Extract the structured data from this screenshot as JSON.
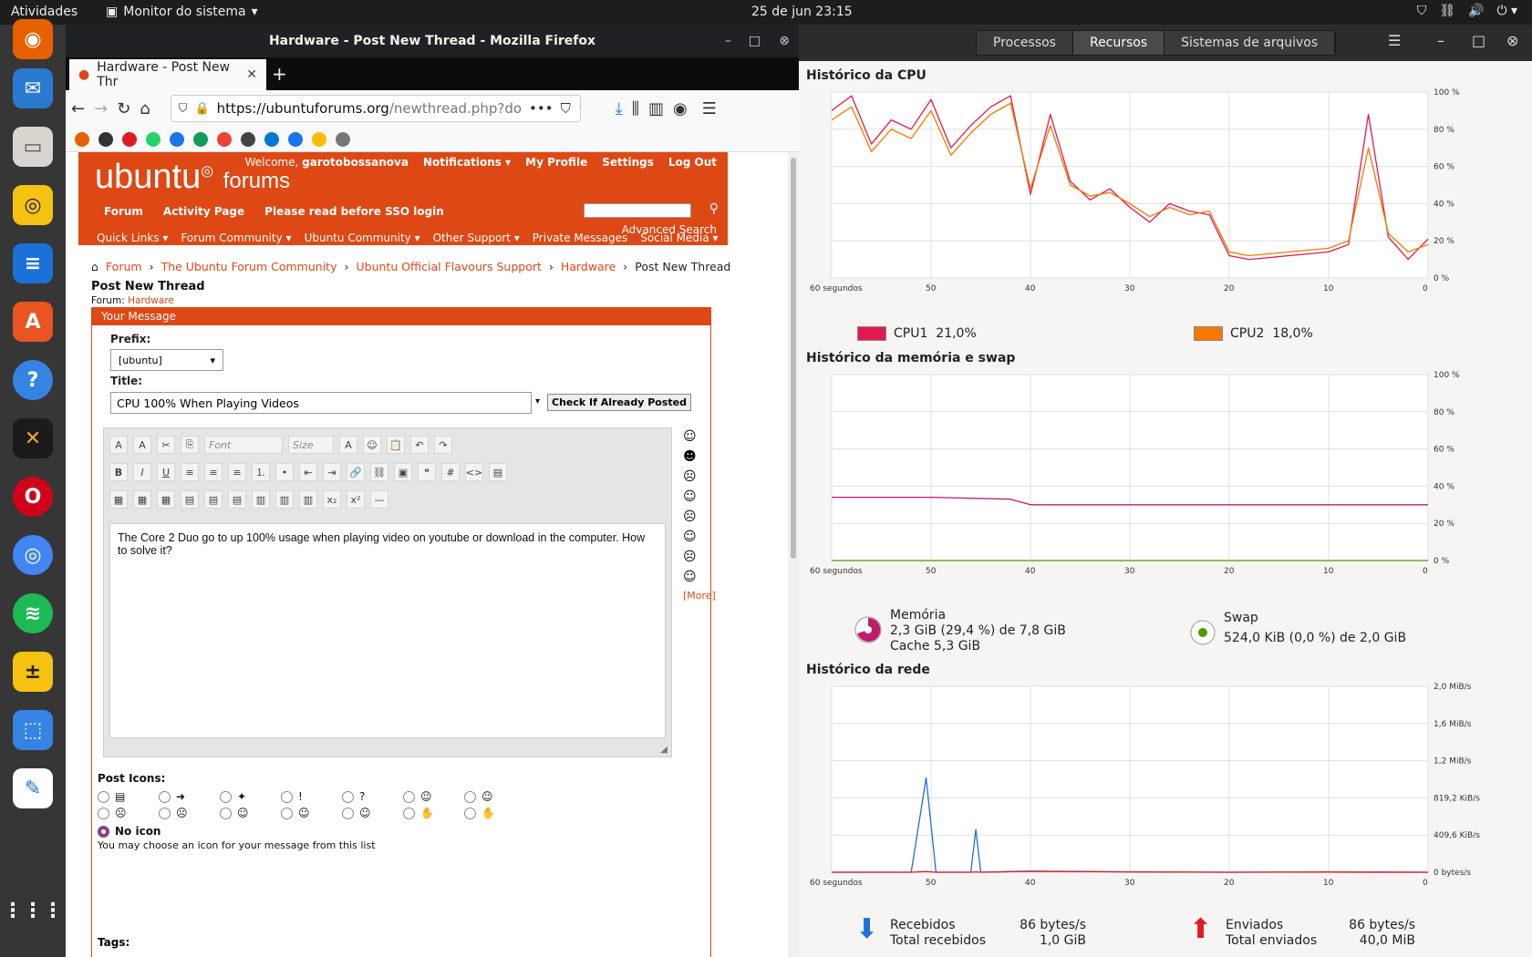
{
  "topbar": {
    "activities": "Atividades",
    "app": "Monitor do sistema",
    "datetime": "25 de jun  23:15"
  },
  "firefox": {
    "window_title": "Hardware - Post New Thread - Mozilla Firefox",
    "tab_title": "Hardware - Post New Thr",
    "url_host": "https://ubuntuforums.org",
    "url_path": "/newthread.php?do",
    "page": {
      "logo": "ubuntu",
      "logo_suffix": "forums",
      "welcome": "Welcome,",
      "username": "garotobossanova",
      "top_links": [
        "Notifications",
        "My Profile",
        "Settings",
        "Log Out"
      ],
      "nav1": [
        "Forum",
        "Activity Page",
        "Please read before SSO login"
      ],
      "nav2": [
        "Quick Links",
        "Forum Community",
        "Ubuntu Community",
        "Other Support",
        "Private Messages",
        "Social Media"
      ],
      "advanced_search": "Advanced Search",
      "breadcrumb": [
        "Forum",
        "The Ubuntu Forum Community",
        "Ubuntu Official Flavours Support",
        "Hardware"
      ],
      "breadcrumb_current": "Post New Thread",
      "heading": "Post New Thread",
      "forum_label": "Forum:",
      "forum_name": "Hardware",
      "panel_title": "Your Message",
      "prefix_label": "Prefix:",
      "prefix_value": "[ubuntu]",
      "title_label": "Title:",
      "title_value": "CPU 100% When Playing Videos",
      "check_button": "Check If Already Posted",
      "font_placeholder": "Font",
      "size_placeholder": "Size",
      "message": "The Core 2 Duo go to up 100% usage when playing video on youtube or download in the computer. How to solve it?",
      "more_smilies": "[More]",
      "post_icons_label": "Post Icons:",
      "no_icon": "No icon",
      "icon_hint": "You may choose an icon for your message from this list",
      "tags_label": "Tags:"
    }
  },
  "monitor": {
    "tabs": [
      "Processos",
      "Recursos",
      "Sistemas de arquivos"
    ],
    "cpu_title": "Histórico da CPU",
    "mem_title": "Histórico da memória e swap",
    "net_title": "Histórico da rede",
    "x_ticks": [
      "60 segundos",
      "50",
      "40",
      "30",
      "20",
      "10",
      "0"
    ],
    "pct_ticks": [
      "100 %",
      "80 %",
      "60 %",
      "40 %",
      "20 %",
      "0 %"
    ],
    "net_ticks": [
      "2,0 MiB/s",
      "1,6 MiB/s",
      "1,2 MiB/s",
      "819,2 KiB/s",
      "409,6 KiB/s",
      "0 bytes/s"
    ],
    "cpu1_label": "CPU1",
    "cpu1_value": "21,0%",
    "cpu2_label": "CPU2",
    "cpu2_value": "18,0%",
    "mem_label": "Memória",
    "mem_value": "2,3 GiB (29,4 %) de 7,8 GiB",
    "mem_cache": "Cache 5,3 GiB",
    "swap_label": "Swap",
    "swap_value": "524,0 KiB (0,0 %) de 2,0 GiB",
    "recv_label": "Recebidos",
    "recv_rate": "86 bytes/s",
    "recv_total_label": "Total recebidos",
    "recv_total": "1,0 GiB",
    "sent_label": "Enviados",
    "sent_rate": "86 bytes/s",
    "sent_total_label": "Total enviados",
    "sent_total": "40,0 MiB",
    "colors": {
      "cpu1": "#e01b4c",
      "cpu2": "#f57900",
      "mem": "#c01c6c",
      "swap": "#4e9a06",
      "recv": "#1c71d8",
      "sent": "#e01b24"
    }
  },
  "chart_data": [
    {
      "type": "line",
      "title": "Histórico da CPU",
      "x": [
        60,
        58,
        56,
        54,
        52,
        50,
        48,
        46,
        44,
        42,
        40,
        38,
        36,
        34,
        32,
        30,
        28,
        26,
        24,
        22,
        20,
        18,
        16,
        14,
        12,
        10,
        8,
        6,
        4,
        2,
        0
      ],
      "series": [
        {
          "name": "CPU1",
          "values": [
            90,
            98,
            72,
            85,
            80,
            96,
            70,
            82,
            92,
            98,
            45,
            88,
            52,
            42,
            48,
            38,
            30,
            40,
            36,
            34,
            12,
            10,
            11,
            12,
            13,
            14,
            18,
            88,
            22,
            10,
            21
          ]
        },
        {
          "name": "CPU2",
          "values": [
            85,
            92,
            68,
            80,
            75,
            90,
            66,
            78,
            88,
            94,
            48,
            82,
            50,
            44,
            46,
            40,
            33,
            38,
            34,
            36,
            14,
            12,
            13,
            14,
            15,
            16,
            20,
            70,
            24,
            14,
            18
          ]
        }
      ],
      "ylim": [
        0,
        100
      ]
    },
    {
      "type": "line",
      "title": "Histórico da memória e swap",
      "x": [
        60,
        50,
        42,
        40,
        30,
        20,
        10,
        0
      ],
      "series": [
        {
          "name": "Memória",
          "values": [
            34,
            34,
            33,
            30,
            30,
            30,
            30,
            30
          ]
        },
        {
          "name": "Swap",
          "values": [
            0,
            0,
            0,
            0,
            0,
            0,
            0,
            0
          ]
        }
      ],
      "ylim": [
        0,
        100
      ]
    },
    {
      "type": "line",
      "title": "Histórico da rede",
      "x": [
        60,
        52,
        50.5,
        49.5,
        48,
        46,
        45.5,
        45,
        40,
        30,
        20,
        10,
        0
      ],
      "series": [
        {
          "name": "Recebidos",
          "values": [
            0,
            0,
            1040,
            0,
            0,
            0,
            470,
            0,
            12,
            4,
            0,
            2,
            0
          ]
        },
        {
          "name": "Enviados",
          "values": [
            0,
            0,
            8,
            0,
            0,
            0,
            4,
            0,
            10,
            4,
            0,
            2,
            0
          ]
        }
      ],
      "ylim": [
        0,
        2048
      ],
      "ylabel": ""
    }
  ]
}
